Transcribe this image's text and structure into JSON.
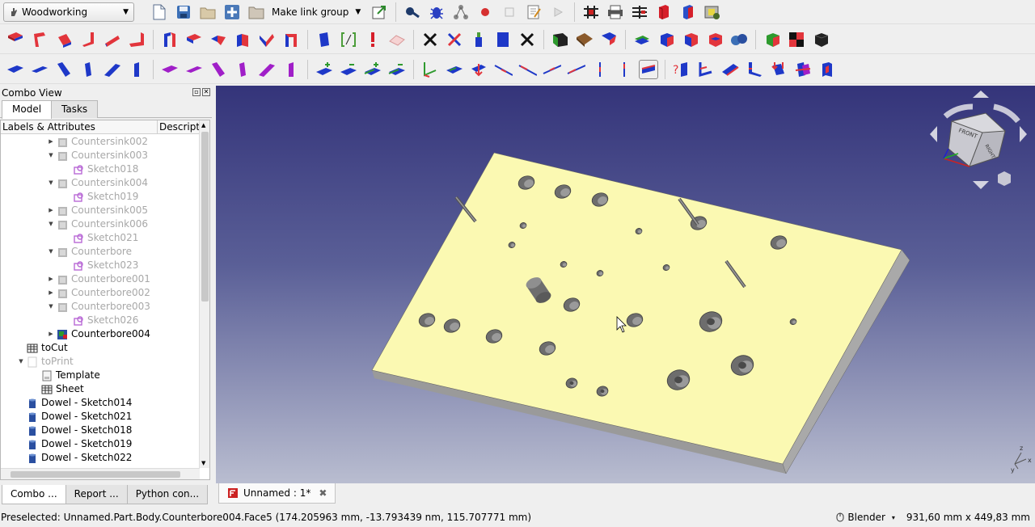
{
  "toolbar": {
    "workbench": "Woodworking",
    "make_link_group": "Make link group"
  },
  "combo": {
    "title": "Combo View",
    "tabs": [
      "Model",
      "Tasks"
    ],
    "tree_header": {
      "labels": "Labels & Attributes",
      "description": "Descripti"
    },
    "tree": [
      {
        "label": "Countersink002",
        "indent": 1,
        "exp": "right",
        "icon": "body",
        "grey": true
      },
      {
        "label": "Countersink003",
        "indent": 1,
        "exp": "down",
        "icon": "body",
        "grey": true
      },
      {
        "label": "Sketch018",
        "indent": 2,
        "exp": "",
        "icon": "sketch",
        "grey": true
      },
      {
        "label": "Countersink004",
        "indent": 1,
        "exp": "down",
        "icon": "body",
        "grey": true
      },
      {
        "label": "Sketch019",
        "indent": 2,
        "exp": "",
        "icon": "sketch",
        "grey": true
      },
      {
        "label": "Countersink005",
        "indent": 1,
        "exp": "right",
        "icon": "body",
        "grey": true
      },
      {
        "label": "Countersink006",
        "indent": 1,
        "exp": "down",
        "icon": "body",
        "grey": true
      },
      {
        "label": "Sketch021",
        "indent": 2,
        "exp": "",
        "icon": "sketch",
        "grey": true
      },
      {
        "label": "Counterbore",
        "indent": 1,
        "exp": "down",
        "icon": "body",
        "grey": true
      },
      {
        "label": "Sketch023",
        "indent": 2,
        "exp": "",
        "icon": "sketch",
        "grey": true
      },
      {
        "label": "Counterbore001",
        "indent": 1,
        "exp": "right",
        "icon": "body",
        "grey": true
      },
      {
        "label": "Counterbore002",
        "indent": 1,
        "exp": "right",
        "icon": "body",
        "grey": true
      },
      {
        "label": "Counterbore003",
        "indent": 1,
        "exp": "down",
        "icon": "body",
        "grey": true
      },
      {
        "label": "Sketch026",
        "indent": 2,
        "exp": "",
        "icon": "sketch",
        "grey": true
      },
      {
        "label": "Counterbore004",
        "indent": 1,
        "exp": "right",
        "icon": "body-color",
        "grey": false
      },
      {
        "label": "toCut",
        "indent": -1,
        "exp": "",
        "icon": "sheet",
        "grey": false
      },
      {
        "label": "toPrint",
        "indent": -1,
        "exp": "down",
        "icon": "page",
        "grey": true
      },
      {
        "label": "Template",
        "indent": 0,
        "exp": "",
        "icon": "template",
        "grey": false
      },
      {
        "label": "Sheet",
        "indent": 0,
        "exp": "",
        "icon": "sheet",
        "grey": false
      },
      {
        "label": "Dowel - Sketch014",
        "indent": -1,
        "exp": "",
        "icon": "dowel",
        "grey": false
      },
      {
        "label": "Dowel - Sketch021",
        "indent": -1,
        "exp": "",
        "icon": "dowel",
        "grey": false
      },
      {
        "label": "Dowel - Sketch018",
        "indent": -1,
        "exp": "",
        "icon": "dowel",
        "grey": false
      },
      {
        "label": "Dowel - Sketch019",
        "indent": -1,
        "exp": "",
        "icon": "dowel",
        "grey": false
      },
      {
        "label": "Dowel - Sketch022",
        "indent": -1,
        "exp": "",
        "icon": "dowel",
        "grey": false
      }
    ]
  },
  "dock_tabs": [
    "Combo ...",
    "Report ...",
    "Python con..."
  ],
  "document_tab": "Unnamed : 1*",
  "navcube": {
    "front": "FRONT",
    "right": "RIGHT"
  },
  "status": {
    "message": "Preselected: Unnamed.Part.Body.Counterbore004.Face5 (174.205963 mm, -13.793439 nm, 115.707771 mm)",
    "navigation_style": "Blender",
    "dimensions": "931,60 mm x 449,83 mm"
  },
  "colors": {
    "board_top": "#fbf9b2",
    "board_side": "#9a9a9a",
    "view_top": "#34347a",
    "view_bottom": "#b9bdd0"
  }
}
